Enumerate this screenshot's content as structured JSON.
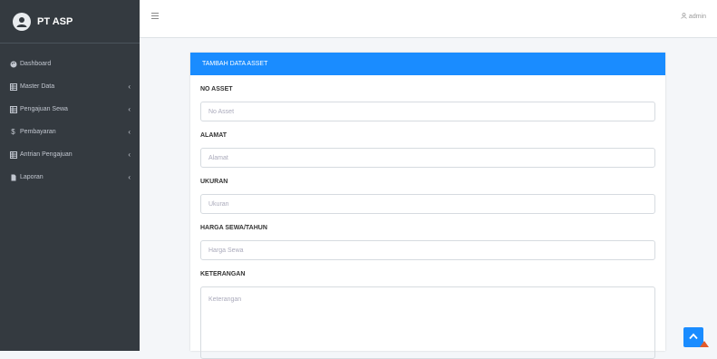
{
  "brand": {
    "name": "PT ASP",
    "logo_icon": "user-avatar-icon"
  },
  "sidebar": {
    "items": [
      {
        "label": "Dashboard",
        "icon": "palette-icon",
        "has_arrow": false
      },
      {
        "label": "Master Data",
        "icon": "table-icon",
        "has_arrow": true
      },
      {
        "label": "Pengajuan Sewa",
        "icon": "table-icon",
        "has_arrow": true
      },
      {
        "label": "Pembayaran",
        "icon": "dollar-icon",
        "has_arrow": true
      },
      {
        "label": "Antrian Pengajuan",
        "icon": "table-icon",
        "has_arrow": true
      },
      {
        "label": "Laporan",
        "icon": "file-icon",
        "has_arrow": true
      }
    ]
  },
  "topbar": {
    "menu_icon": "hamburger-icon",
    "user_label": "admin",
    "user_icon": "user-icon"
  },
  "form": {
    "title": "TAMBAH DATA ASSET",
    "fields": [
      {
        "label": "NO ASSET",
        "placeholder": "No Asset"
      },
      {
        "label": "ALAMAT",
        "placeholder": "Alamat"
      },
      {
        "label": "UKURAN",
        "placeholder": "Ukuran"
      },
      {
        "label": "HARGA SEWA/TAHUN",
        "placeholder": "Harga Sewa"
      },
      {
        "label": "KETERANGAN",
        "placeholder": "Keterangan"
      }
    ]
  },
  "colors": {
    "sidebar_bg": "#343a40",
    "primary": "#1a8cff",
    "content_bg": "#f4f6f9"
  }
}
